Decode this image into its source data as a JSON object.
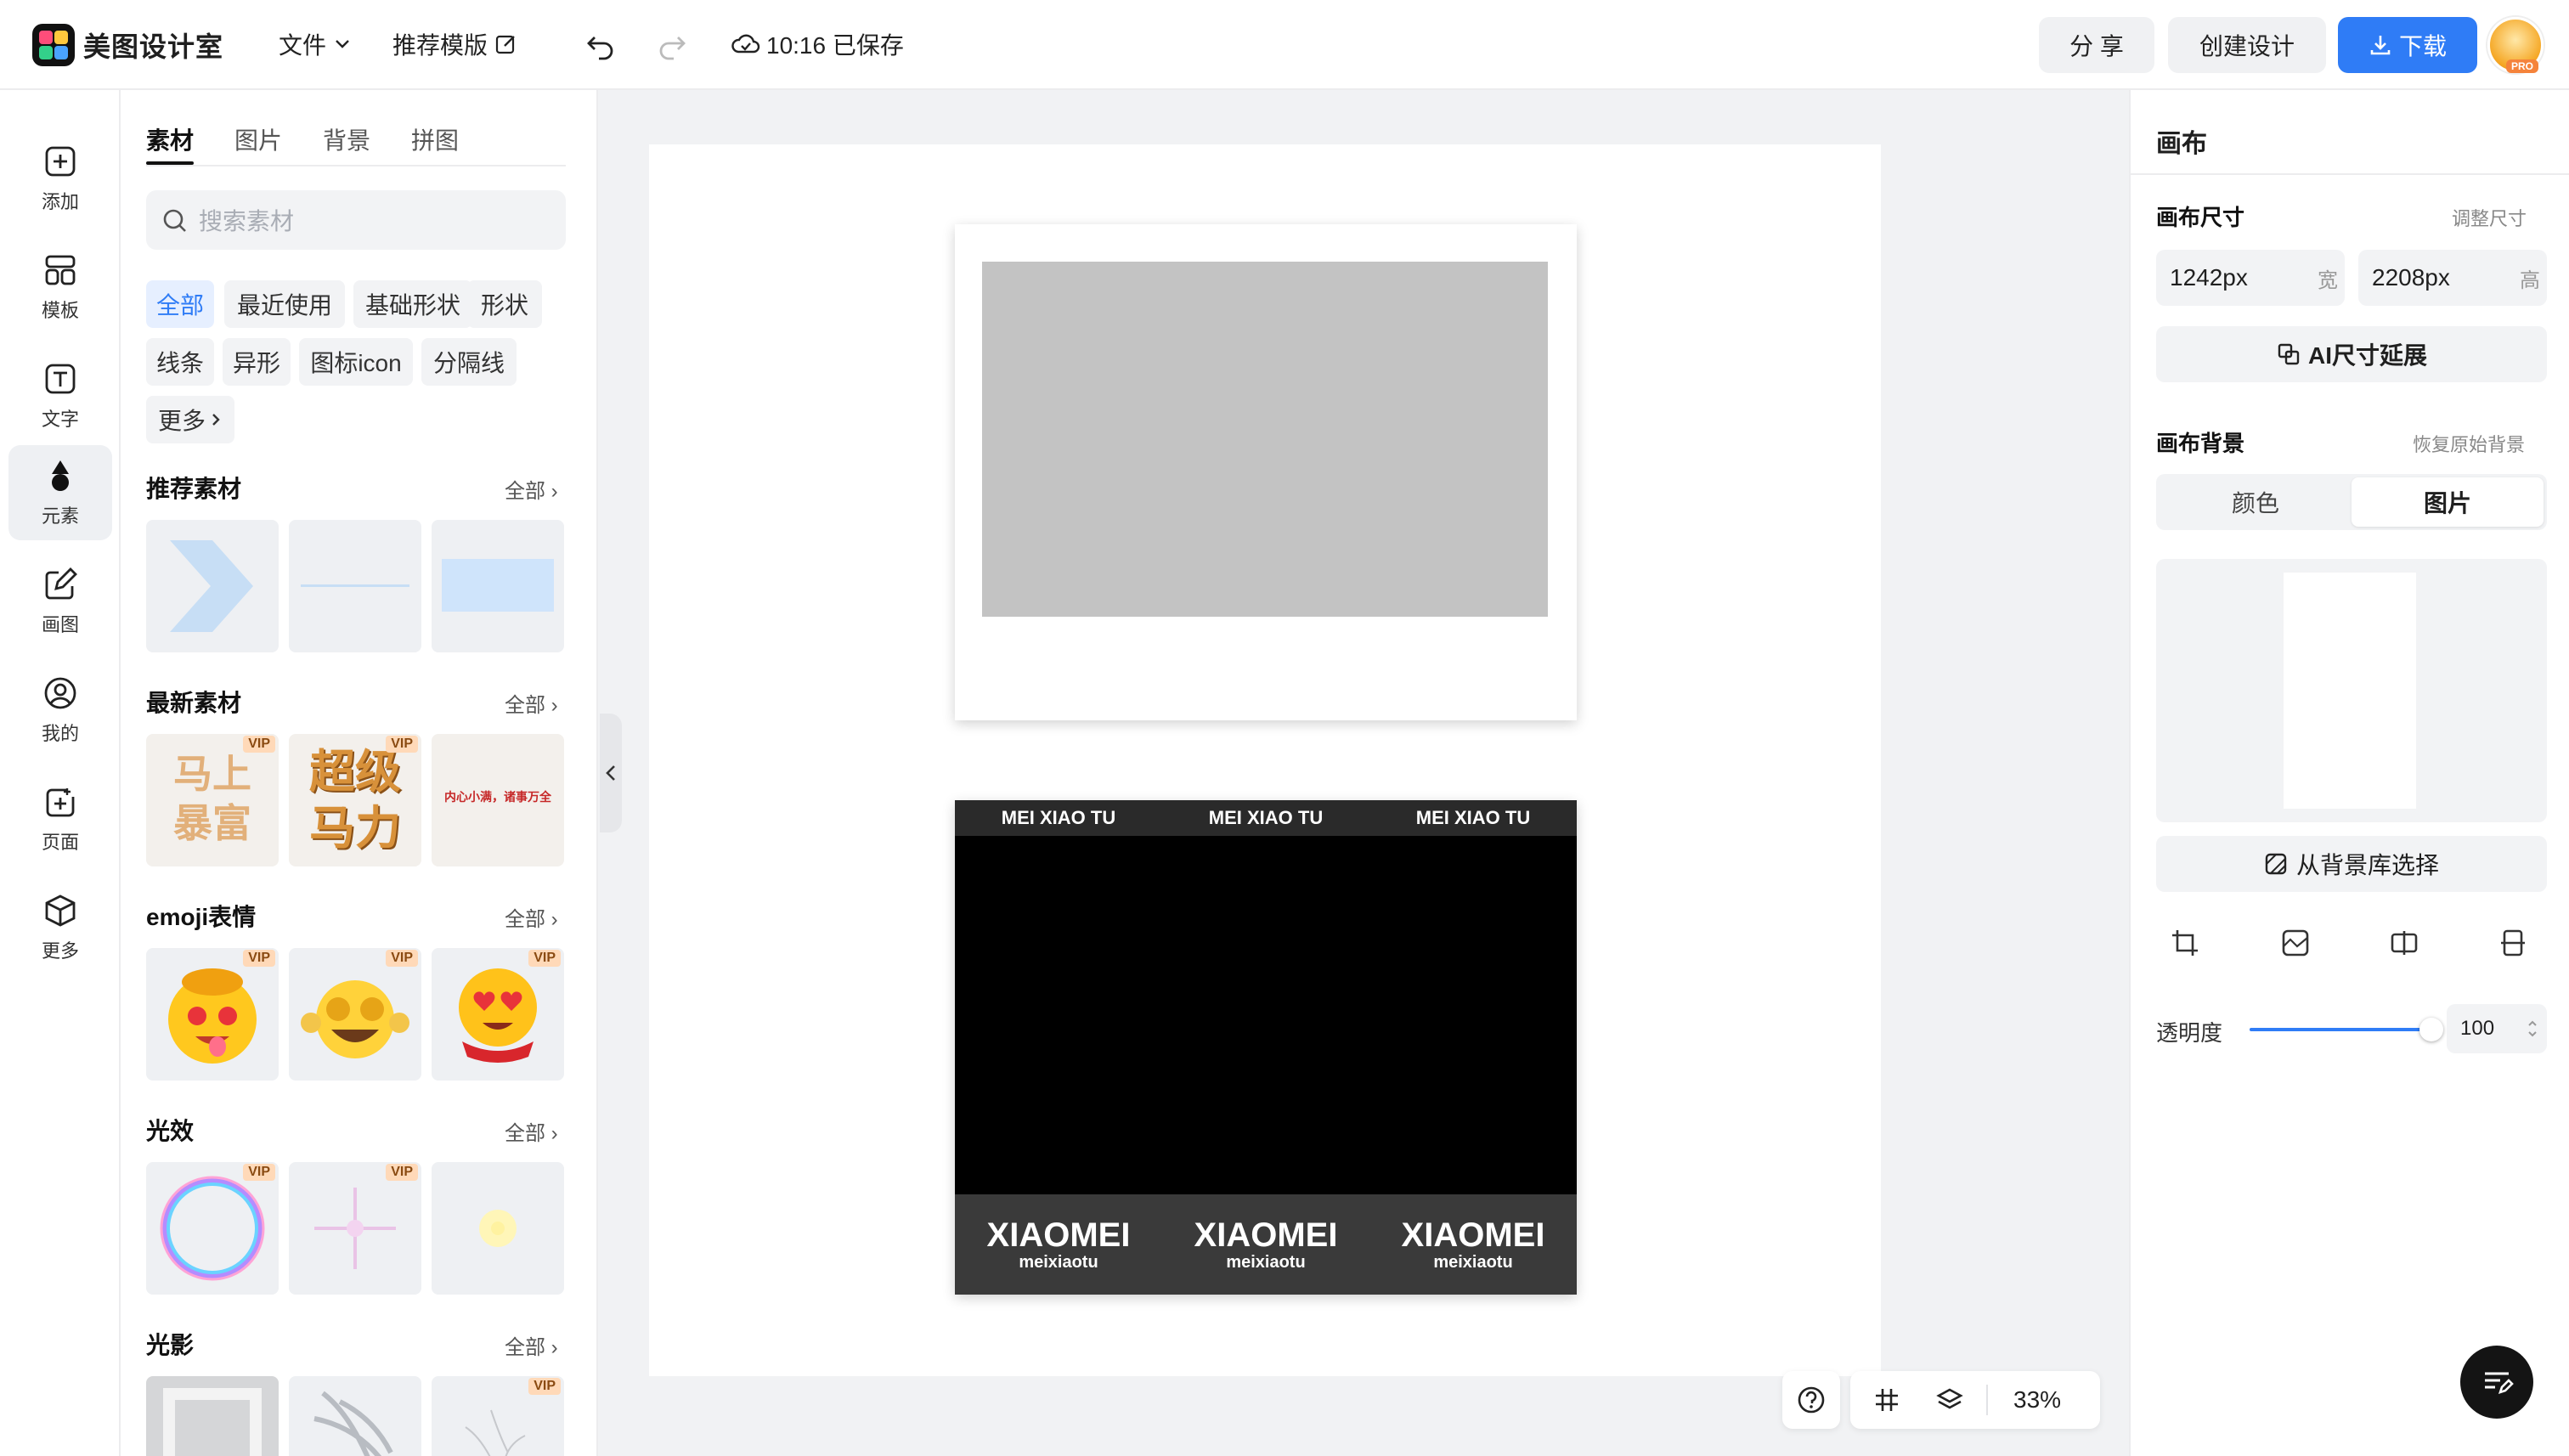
{
  "header": {
    "brand": "美图设计室",
    "menu_file": "文件",
    "menu_template": "推荐模版",
    "save_status": "10:16 已保存",
    "share": "分 享",
    "create": "创建设计",
    "download": "下载",
    "pro_badge": "PRO"
  },
  "rail": [
    {
      "label": "添加",
      "icon": "plus-square-icon"
    },
    {
      "label": "模板",
      "icon": "template-icon"
    },
    {
      "label": "文字",
      "icon": "text-icon"
    },
    {
      "label": "元素",
      "icon": "shapes-icon"
    },
    {
      "label": "画图",
      "icon": "draw-icon"
    },
    {
      "label": "我的",
      "icon": "user-icon"
    },
    {
      "label": "页面",
      "icon": "page-add-icon"
    },
    {
      "label": "更多",
      "icon": "box-icon"
    }
  ],
  "panel": {
    "tabs": [
      "素材",
      "图片",
      "背景",
      "拼图"
    ],
    "search_placeholder": "搜索素材",
    "chips": [
      "全部",
      "最近使用",
      "基础形状",
      "形状",
      "线条",
      "异形",
      "图标icon",
      "分隔线",
      "更多"
    ],
    "all_label": "全部",
    "vip": "VIP",
    "sections": [
      {
        "title": "推荐素材"
      },
      {
        "title": "最新素材",
        "tile_texts": [
          "马上暴富",
          "超级马力",
          "内心小满，诸事万全"
        ]
      },
      {
        "title": "emoji表情"
      },
      {
        "title": "光效"
      },
      {
        "title": "光影"
      }
    ]
  },
  "canvas": {
    "frame2_top": [
      "MEI XIAO TU",
      "MEI XIAO TU",
      "MEI XIAO TU"
    ],
    "frame2_big": [
      "XIAOMEI",
      "XIAOMEI",
      "XIAOMEI"
    ],
    "frame2_small": [
      "meixiaotu",
      "meixiaotu",
      "meixiaotu"
    ]
  },
  "toolbar": {
    "zoom": "33%"
  },
  "right": {
    "title": "画布",
    "size_label": "画布尺寸",
    "resize_link": "调整尺寸",
    "width_value": "1242px",
    "width_unit": "宽",
    "height_value": "2208px",
    "height_unit": "高",
    "ai_extend": "AI尺寸延展",
    "bg_label": "画布背景",
    "restore_link": "恢复原始背景",
    "bg_tabs": [
      "颜色",
      "图片"
    ],
    "bg_library": "从背景库选择",
    "opacity_label": "透明度",
    "opacity_value": "100",
    "opacity_level": 1.0
  },
  "colors": {
    "accent": "#2f7cf6",
    "active_chip_bg": "#e6efff"
  }
}
